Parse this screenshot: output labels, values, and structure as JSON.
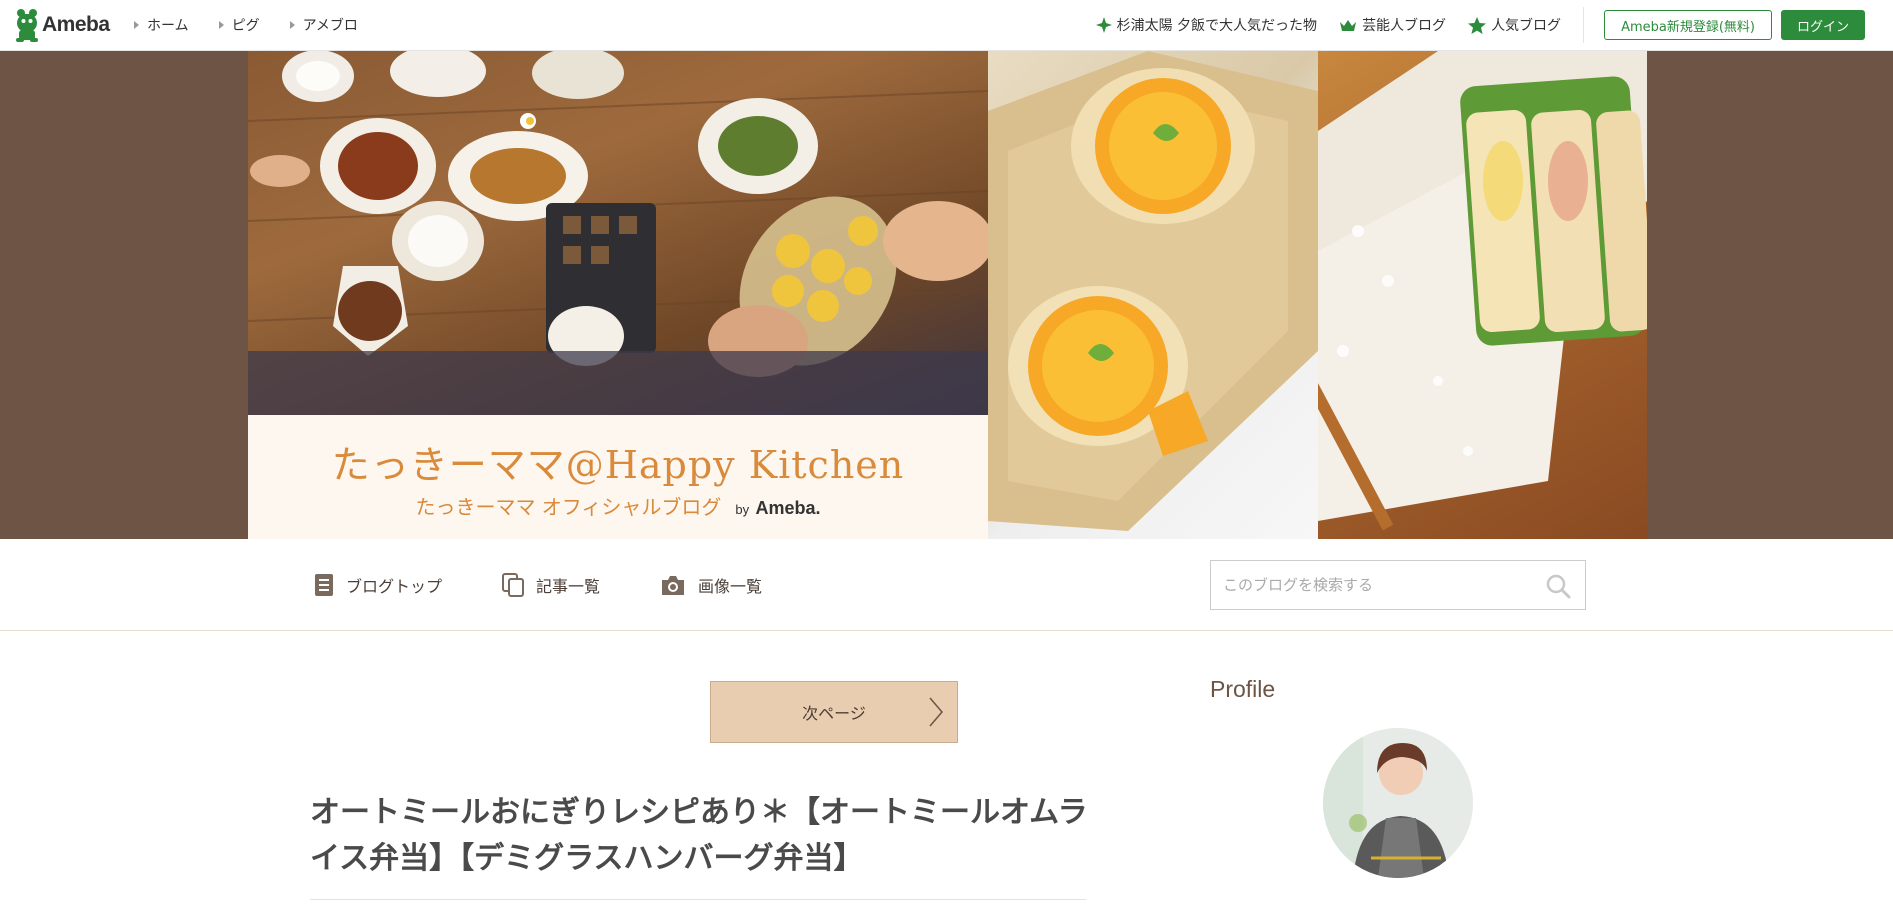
{
  "global": {
    "logo_text": "Ameba",
    "nav": [
      {
        "label": "ホーム"
      },
      {
        "label": "ピグ"
      },
      {
        "label": "アメブロ"
      }
    ],
    "right_links": [
      {
        "label": "杉浦太陽 夕飯で大人気だった物",
        "icon": "sparkle-icon"
      },
      {
        "label": "芸能人ブログ",
        "icon": "crown-icon"
      },
      {
        "label": "人気ブログ",
        "icon": "star-icon"
      }
    ],
    "register_label": "Ameba新規登録(無料)",
    "login_label": "ログイン"
  },
  "header": {
    "blog_title": "たっきーママ@Happy Kitchen",
    "blog_subtitle": "たっきーママ オフィシャルブログ",
    "by_label": "by",
    "by_brand": "Ameba."
  },
  "blog_nav": {
    "items": [
      {
        "label": "ブログトップ",
        "icon": "document-icon"
      },
      {
        "label": "記事一覧",
        "icon": "copy-icon"
      },
      {
        "label": "画像一覧",
        "icon": "camera-icon"
      }
    ],
    "search_placeholder": "このブログを検索する"
  },
  "main": {
    "next_page_label": "次ページ",
    "entry_title": "オートミールおにぎりレシピあり＊【オートミールオムライス弁当】【デミグラスハンバーグ弁当】"
  },
  "sidebar": {
    "profile_heading": "Profile"
  },
  "colors": {
    "brand_green": "#2d8c3c",
    "banner_brown": "#6d5444",
    "title_orange": "#d98a3a",
    "next_button_bg": "#e9cdb0"
  }
}
